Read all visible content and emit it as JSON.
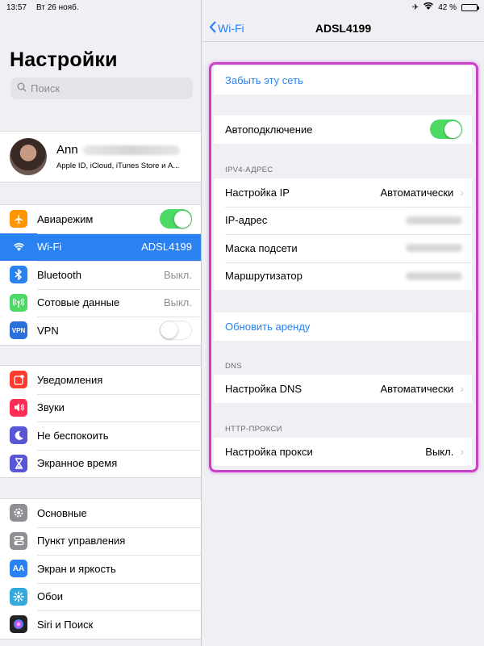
{
  "status_bar": {
    "time": "13:57",
    "date": "Вт 26 нояб.",
    "battery_percent": "42 %",
    "battery_level": 0.42
  },
  "left": {
    "title": "Настройки",
    "search_placeholder": "Поиск",
    "profile": {
      "name": "Ann",
      "subtitle": "Apple ID, iCloud, iTunes Store и А..."
    },
    "group1": [
      {
        "label": "Авиарежим",
        "icon": "airplane-icon",
        "color": "#ff9500",
        "toggle": "on"
      },
      {
        "label": "Wi-Fi",
        "value": "ADSL4199",
        "icon": "wifi-icon",
        "color": "#2a82f2",
        "selected": true
      },
      {
        "label": "Bluetooth",
        "value": "Выкл.",
        "icon": "bluetooth-icon",
        "color": "#2a82f2"
      },
      {
        "label": "Сотовые данные",
        "value": "Выкл.",
        "icon": "cellular-icon",
        "color": "#4cd964"
      },
      {
        "label": "VPN",
        "icon_text": "VPN",
        "icon": "vpn-icon",
        "color": "#2a6fdb",
        "toggle": "off"
      }
    ],
    "group2": [
      {
        "label": "Уведомления",
        "icon": "notifications-icon",
        "color": "#ff3b30"
      },
      {
        "label": "Звуки",
        "icon": "sounds-icon",
        "color": "#ff2d55"
      },
      {
        "label": "Не беспокоить",
        "icon": "moon-icon",
        "color": "#5856d6"
      },
      {
        "label": "Экранное время",
        "icon": "hourglass-icon",
        "color": "#5856d6"
      }
    ],
    "group3": [
      {
        "label": "Основные",
        "icon": "gear-icon",
        "color": "#8e8e93"
      },
      {
        "label": "Пункт управления",
        "icon": "switches-icon",
        "color": "#8e8e93"
      },
      {
        "label": "Экран и яркость",
        "icon_text": "AA",
        "icon": "display-icon",
        "color": "#2a82f2"
      },
      {
        "label": "Обои",
        "icon": "wallpaper-icon",
        "color": "#34aadc"
      },
      {
        "label": "Siri и Поиск",
        "icon": "siri-icon",
        "color": "#222"
      }
    ]
  },
  "right": {
    "back_label": "Wi-Fi",
    "title": "ADSL4199",
    "forget_network": "Забыть эту сеть",
    "auto_join": "Автоподключение",
    "ipv4_header": "IPV4-АДРЕС",
    "ipv4_rows": [
      {
        "label": "Настройка IP",
        "value": "Автоматически",
        "chevron": true
      },
      {
        "label": "IP-адрес",
        "blurred": true
      },
      {
        "label": "Маска подсети",
        "blurred": true
      },
      {
        "label": "Маршрутизатор",
        "blurred": true
      }
    ],
    "renew_lease": "Обновить аренду",
    "dns_header": "DNS",
    "dns_row": {
      "label": "Настройка DNS",
      "value": "Автоматически"
    },
    "proxy_header": "HTTP-ПРОКСИ",
    "proxy_row": {
      "label": "Настройка прокси",
      "value": "Выкл."
    },
    "highlight_color": "#c940c9"
  }
}
